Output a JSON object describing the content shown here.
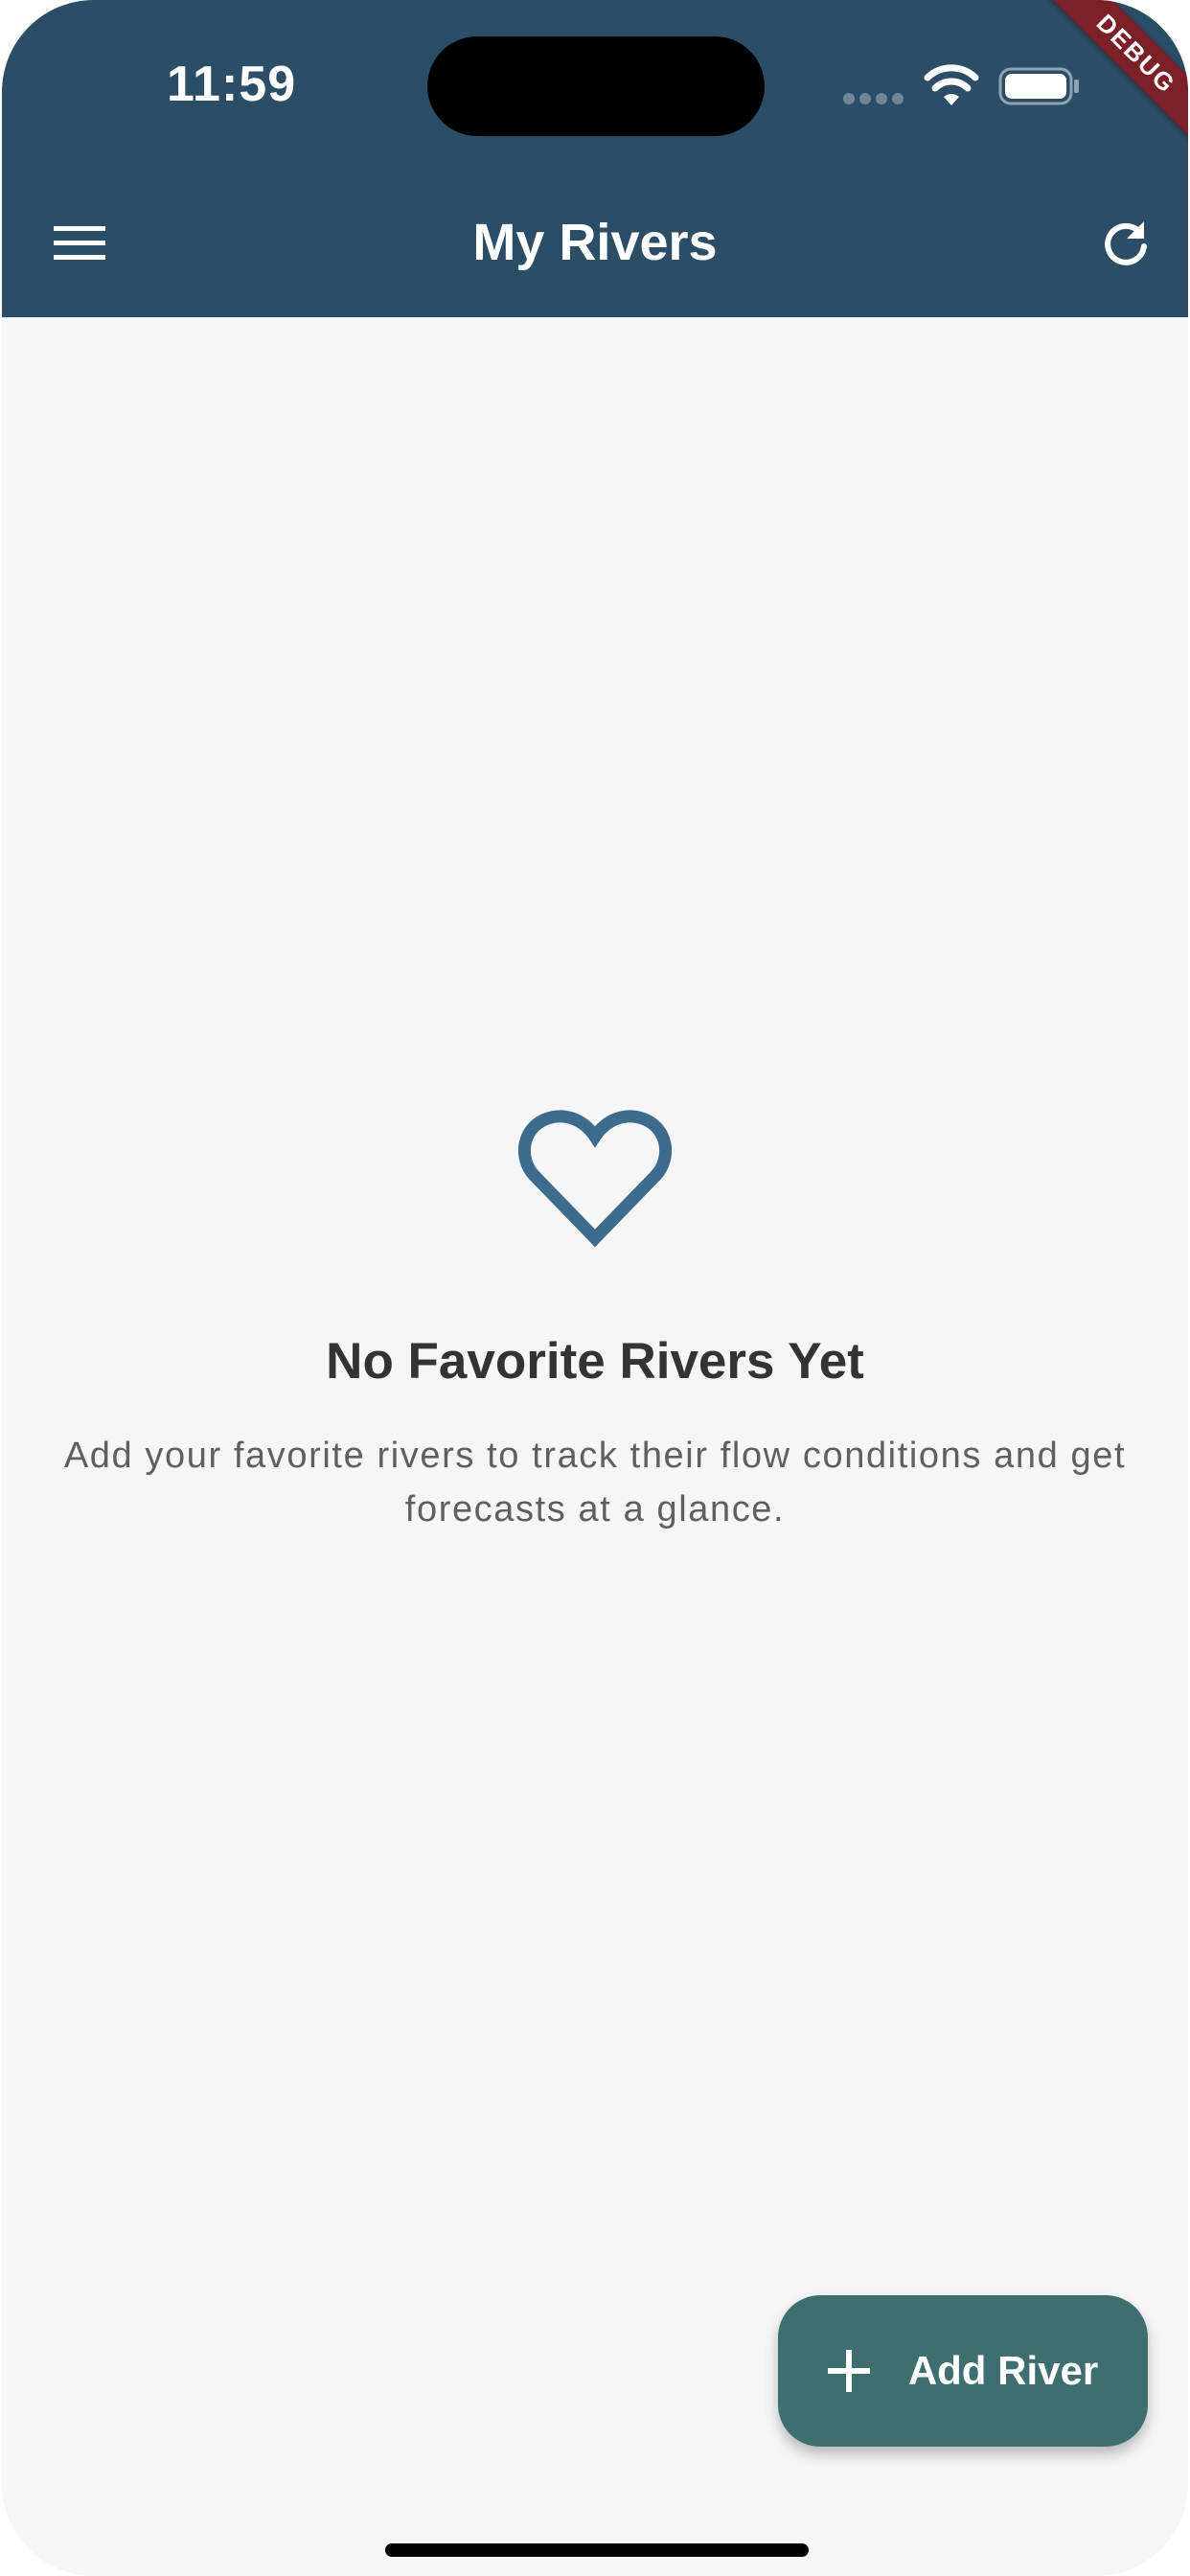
{
  "status_bar": {
    "time": "11:59",
    "icons": [
      "cellular-signal-icon",
      "wifi-icon",
      "battery-icon"
    ]
  },
  "debug_banner": {
    "label": "DEBUG",
    "color": "#7c1f26"
  },
  "app_bar": {
    "title": "My Rivers",
    "background": "#2b4d66",
    "left_icon": "menu-icon",
    "right_icon": "refresh-icon"
  },
  "empty_state": {
    "icon": "heart-outline-icon",
    "icon_color": "#3d6b8e",
    "title": "No Favorite Rivers Yet",
    "message": "Add your favorite rivers to track their flow conditions and get forecasts at a glance."
  },
  "fab": {
    "icon": "plus-icon",
    "label": "Add River",
    "background": "#3d6e70"
  }
}
